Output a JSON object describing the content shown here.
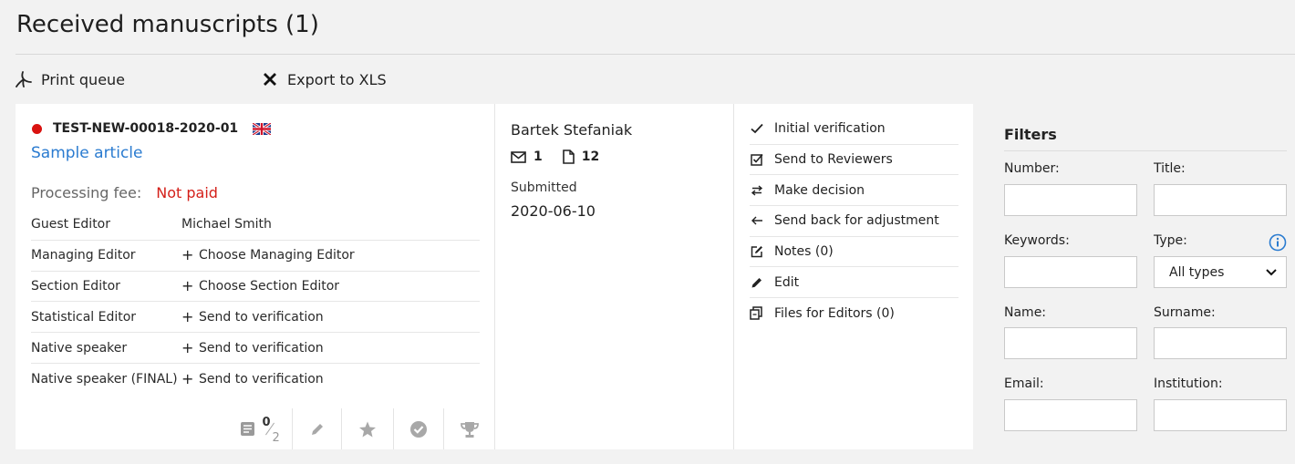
{
  "page": {
    "title": "Received manuscripts (1)"
  },
  "toolbar": {
    "print_label": "Print queue",
    "print_icon": "pdf-icon",
    "export_label": "Export to XLS",
    "export_icon": "excel-x-icon"
  },
  "manuscript": {
    "status_dot_color": "#d9120f",
    "number": "TEST-NEW-00018-2020-01",
    "language_flag": "uk-flag-icon",
    "title": "Sample article",
    "fee_label": "Processing fee:",
    "fee_value": "Not paid",
    "roles": [
      {
        "name": "Guest Editor",
        "value": "Michael Smith",
        "action": false
      },
      {
        "name": "Managing Editor",
        "value": "Choose Managing Editor",
        "action": true
      },
      {
        "name": "Section Editor",
        "value": "Choose Section Editor",
        "action": true
      },
      {
        "name": "Statistical Editor",
        "value": "Send to verification",
        "action": true
      },
      {
        "name": "Native speaker",
        "value": "Send to verification",
        "action": true
      },
      {
        "name": "Native speaker (FINAL)",
        "value": "Send to verification",
        "action": true
      }
    ],
    "reviews_done": "0",
    "reviews_total": "2",
    "author": "Bartek Stefaniak",
    "messages_count": "1",
    "files_count": "12",
    "status_label": "Submitted",
    "status_date": "2020-06-10"
  },
  "actions": [
    {
      "label": "Initial verification",
      "icon": "check-icon"
    },
    {
      "label": "Send to Reviewers",
      "icon": "checkbox-icon"
    },
    {
      "label": "Make decision",
      "icon": "swap-arrows-icon"
    },
    {
      "label": "Send back for adjustment",
      "icon": "arrow-left-icon"
    },
    {
      "label": "Notes (0)",
      "icon": "edit-note-icon"
    },
    {
      "label": "Edit",
      "icon": "pencil-icon"
    },
    {
      "label": "Files for Editors (0)",
      "icon": "copy-files-icon"
    }
  ],
  "filters": {
    "title": "Filters",
    "number_label": "Number:",
    "title_label": "Title:",
    "keywords_label": "Keywords:",
    "type_label": "Type:",
    "type_value": "All types",
    "name_label": "Name:",
    "surname_label": "Surname:",
    "email_label": "Email:",
    "institution_label": "Institution:"
  }
}
